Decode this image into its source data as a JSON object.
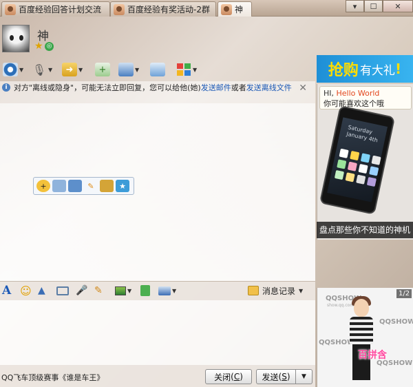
{
  "tabs": [
    {
      "label": "百度经验回答计划交流",
      "active": false
    },
    {
      "label": "百度经验有奖活动-2群",
      "active": false
    },
    {
      "label": "神",
      "active": true
    }
  ],
  "window": {
    "minimize": "▾",
    "close": "✕"
  },
  "contact": {
    "name": "神"
  },
  "notice": {
    "text": "对方\"离线或隐身\"，可能无法立即回复，您可以给他(她)",
    "link_email": "发送邮件",
    "or": "或者",
    "link_file": "发送离线文件",
    "close": "✕"
  },
  "input_toolbar": {
    "history_label": "消息记录"
  },
  "bottom": {
    "ad_text": "QQ飞车顶级赛事《谁是车王》",
    "close_label": "关闭",
    "close_key": "C",
    "send_label": "发送",
    "send_key": "S"
  },
  "side_ad": {
    "banner_big": "抢购",
    "banner_small": "有大礼",
    "banner_excl": "!",
    "bubble_hi": "HI,",
    "bubble_name": "Hello World",
    "bubble_line2": "你可能喜欢这个哦",
    "phone_day": "Saturday",
    "phone_date": "January 4th",
    "caption": "盘点那些你不知道的神机"
  },
  "qqshow": {
    "mark": "QQSHOW",
    "sub": "show.qq.com",
    "page": "1/2",
    "badge": "百拼含"
  },
  "colors": {
    "accent_blue": "#1a58b6",
    "banner_blue": "#1e8fd6",
    "banner_yellow": "#ffdd00"
  }
}
